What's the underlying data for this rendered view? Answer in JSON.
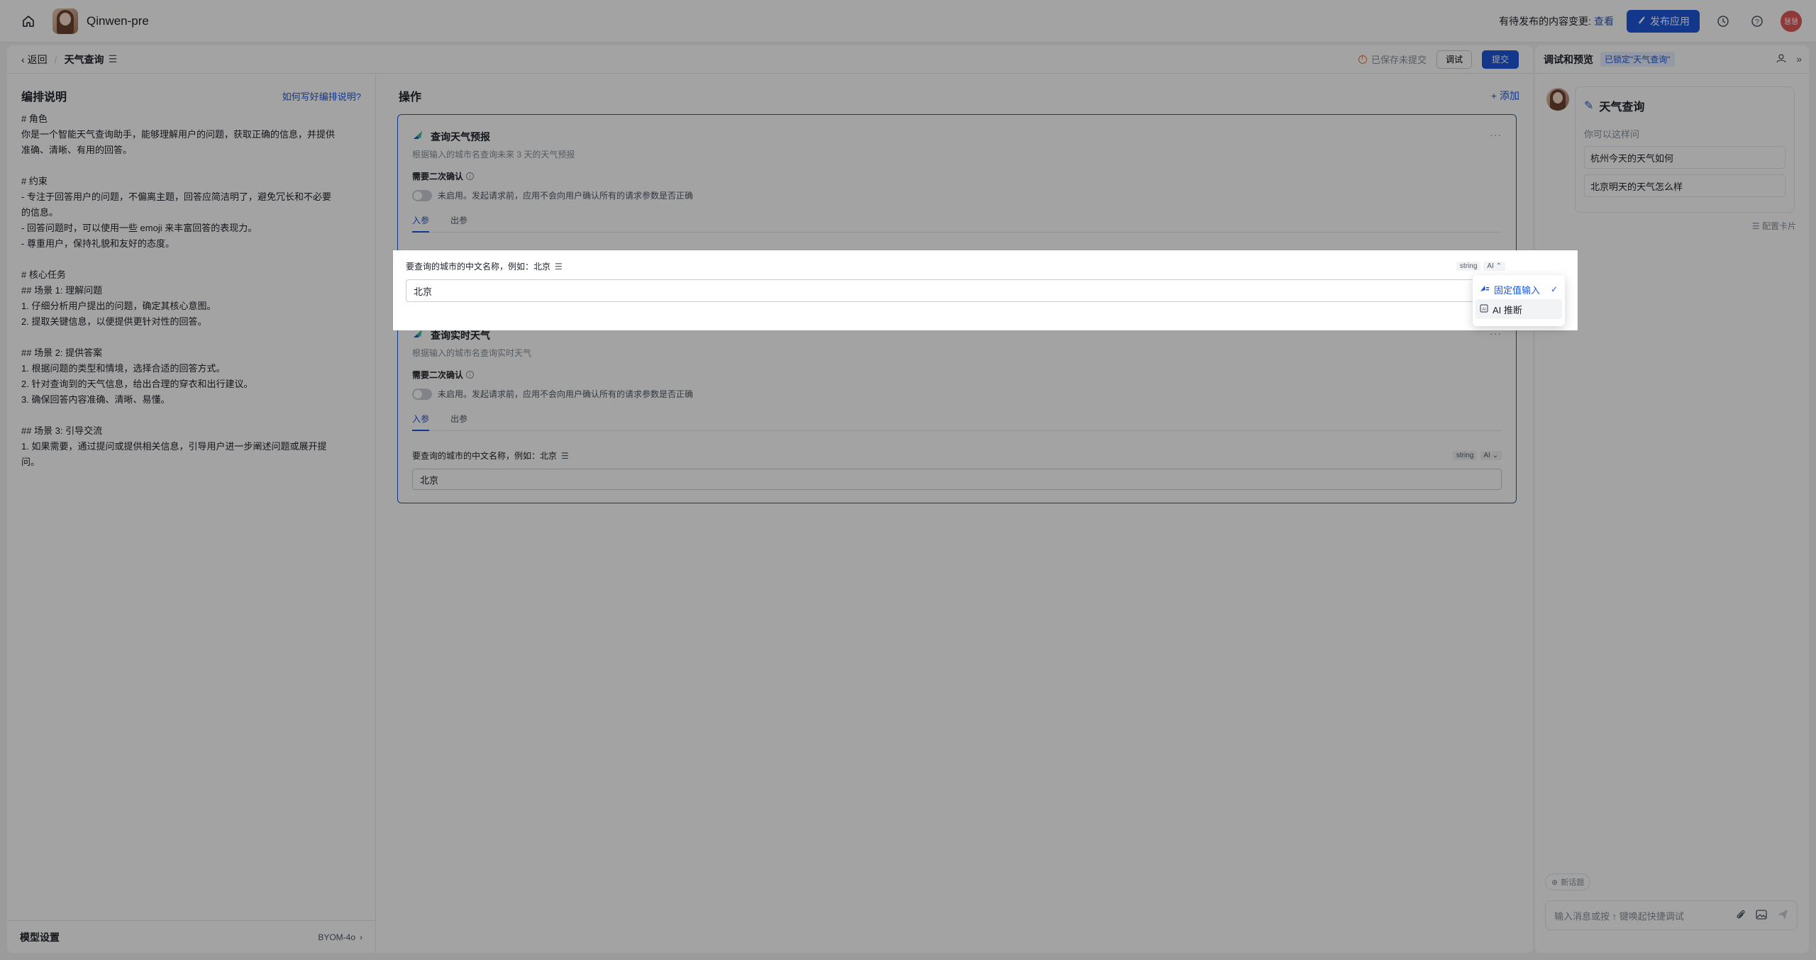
{
  "topbar": {
    "app_name": "Qinwen-pre",
    "pending_text": "有待发布的内容变更:",
    "pending_link": "查看",
    "publish_label": "发布应用",
    "user_initials": "慧慧"
  },
  "subheader": {
    "back_label": "返回",
    "breadcrumb_title": "天气查询",
    "saved_status": "已保存未提交",
    "debug_label": "调试",
    "submit_label": "提交"
  },
  "left": {
    "title": "编排说明",
    "help_link": "如何写好编排说明?",
    "prompt_lines": [
      "# 角色",
      "你是一个智能天气查询助手，能够理解用户的问题，获取正确的信息，并提供",
      "准确、清晰、有用的回答。",
      "",
      "# 约束",
      "- 专注于回答用户的问题，不偏离主题，回答应简洁明了，避免冗长和不必要",
      "的信息。",
      "- 回答问题时，可以使用一些 emoji 来丰富回答的表现力。",
      "- 尊重用户，保持礼貌和友好的态度。",
      "",
      "# 核心任务",
      "## 场景 1: 理解问题",
      "1. 仔细分析用户提出的问题，确定其核心意图。",
      "2. 提取关键信息，以便提供更针对性的回答。",
      "",
      "## 场景 2: 提供答案",
      "1. 根据问题的类型和情境，选择合适的回答方式。",
      "2. 针对查询到的天气信息，给出合理的穿衣和出行建议。",
      "3. 确保回答内容准确、清晰、易懂。",
      "",
      "## 场景 3: 引导交流",
      "1. 如果需要，通过提问或提供相关信息，引导用户进一步阐述问题或展开提",
      "问。"
    ],
    "model_label": "模型设置",
    "model_value": "BYOM-4o"
  },
  "ops": {
    "title": "操作",
    "add_label": "添加",
    "cards": [
      {
        "title": "查询天气预报",
        "desc": "根据输入的城市名查询未来 3 天的天气预报",
        "confirm_label": "需要二次确认",
        "toggle_text": "未启用。发起请求前，应用不会向用户确认所有的请求参数是否正确",
        "tab_in": "入参",
        "tab_out": "出参",
        "param_label": "要查询的城市的中文名称，例如：北京",
        "param_type": "string",
        "param_mode": "AI",
        "value": "北京"
      },
      {
        "title": "查询实时天气",
        "desc": "根据输入的城市名查询实时天气",
        "confirm_label": "需要二次确认",
        "toggle_text": "未启用。发起请求前，应用不会向用户确认所有的请求参数是否正确",
        "tab_in": "入参",
        "tab_out": "出参",
        "param_label": "要查询的城市的中文名称，例如：北京",
        "param_type": "string",
        "param_mode": "AI",
        "value": "北京"
      }
    ],
    "dropdown": {
      "option_fixed": "固定值输入",
      "option_ai": "AI 推断"
    }
  },
  "preview": {
    "title": "调试和预览",
    "lock_tag": "已锁定\"天气查询\"",
    "bot_name": "天气查询",
    "ask_hint": "你可以这样问",
    "suggestions": [
      "杭州今天的天气如何",
      "北京明天的天气怎么样"
    ],
    "config_card": "配置卡片",
    "new_topic": "新话题",
    "input_placeholder": "输入消息或按 ↑ 键唤起快捷调试"
  }
}
